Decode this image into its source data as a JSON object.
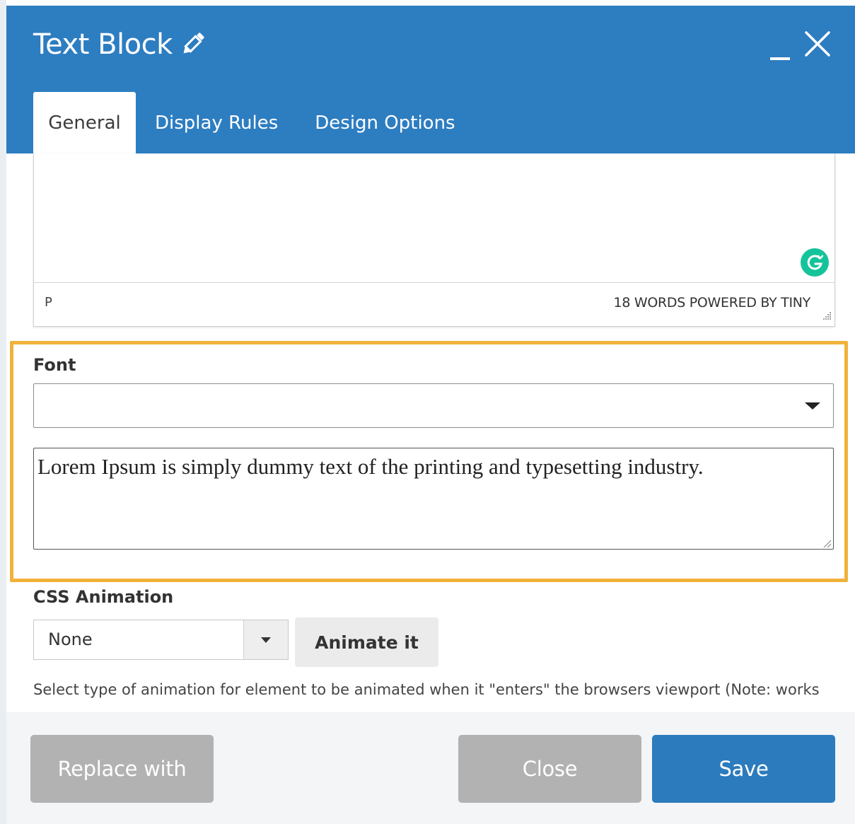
{
  "dialog": {
    "title": "Text Block",
    "title_icon": "pencil-icon",
    "minimize_icon": "minimize-icon",
    "close_icon": "close-icon"
  },
  "tabs": [
    {
      "label": "General",
      "active": true
    },
    {
      "label": "Display Rules",
      "active": false
    },
    {
      "label": "Design Options",
      "active": false
    }
  ],
  "editor": {
    "status_path": "P",
    "status_words": "18 WORDS POWERED BY TINY",
    "grammarly_icon": "grammarly-icon"
  },
  "font": {
    "label": "Font",
    "selected_value": "",
    "preview_text": "Lorem Ipsum is simply dummy text of the printing and typesetting industry."
  },
  "css_animation": {
    "label": "CSS Animation",
    "selected_value": "None",
    "animate_button": "Animate it",
    "help_text": "Select type of animation for element to be animated when it \"enters\" the browsers viewport (Note: works"
  },
  "footer": {
    "replace_label": "Replace with",
    "close_label": "Close",
    "save_label": "Save"
  },
  "colors": {
    "header": "#2d7dc1",
    "highlight": "#f0b23b",
    "save_button": "#2c7bbd",
    "disabled_button": "#b2b2b2",
    "grammarly": "#15c39a"
  }
}
